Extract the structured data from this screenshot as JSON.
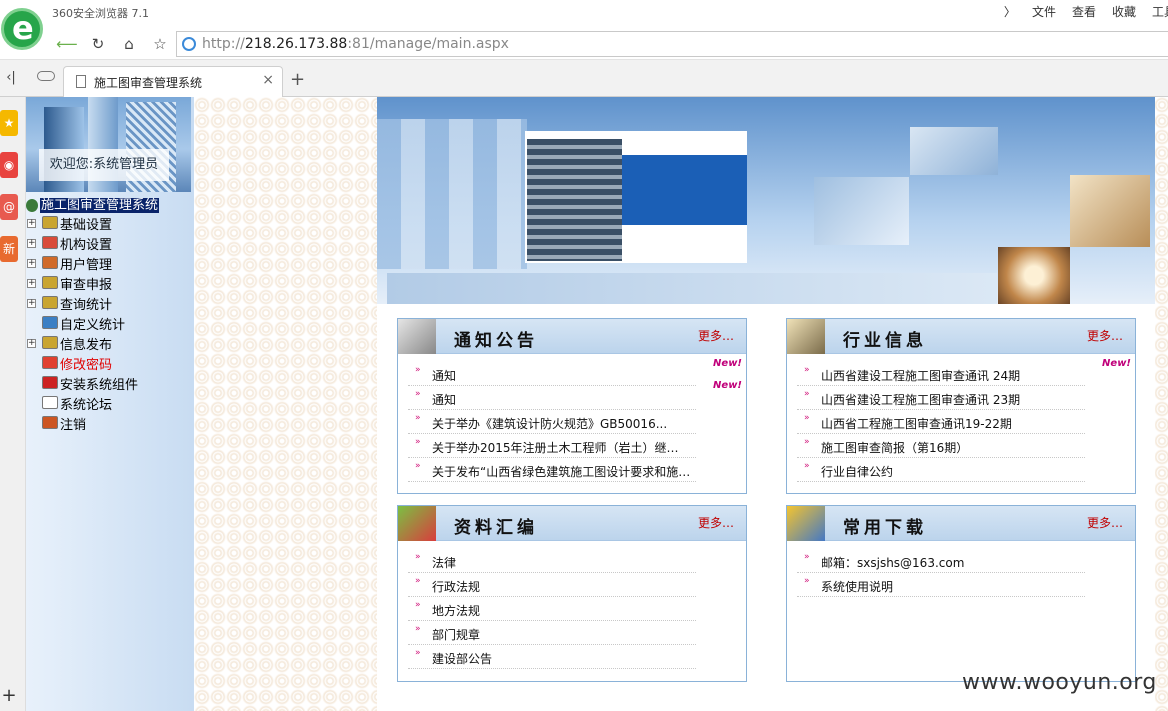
{
  "browser": {
    "app_title": "360安全浏览器 7.1",
    "menu": [
      "文件",
      "查看",
      "收藏",
      "工具"
    ],
    "url_prefix": "http://",
    "url_host": "218.26.173.88",
    "url_rest": ":81/manage/main.aspx",
    "tab_title": "施工图审查管理系统"
  },
  "left": {
    "welcome": "欢迎您:系统管理员",
    "root": "施工图审查管理系统",
    "nodes": [
      {
        "label": "基础设置",
        "expand": "+",
        "color": "#000"
      },
      {
        "label": "机构设置",
        "expand": "+",
        "color": "#000"
      },
      {
        "label": "用户管理",
        "expand": "+",
        "color": "#000"
      },
      {
        "label": "审查申报",
        "expand": "+",
        "color": "#000"
      },
      {
        "label": "查询统计",
        "expand": "+",
        "color": "#000"
      },
      {
        "label": "自定义统计",
        "expand": "",
        "color": "#000"
      },
      {
        "label": "信息发布",
        "expand": "+",
        "color": "#000"
      },
      {
        "label": "修改密码",
        "expand": "",
        "color": "#e00000"
      },
      {
        "label": "安装系统组件",
        "expand": "",
        "color": "#000"
      },
      {
        "label": "系统论坛",
        "expand": "",
        "color": "#000"
      },
      {
        "label": "注销",
        "expand": "",
        "color": "#000"
      }
    ]
  },
  "panels": {
    "notice": {
      "title": "通知公告",
      "more": "更多…",
      "items": [
        "通知",
        "通知",
        "关于举办《建筑设计防火规范》GB50016...",
        "关于举办2015年注册土木工程师（岩土）继…",
        "关于发布“山西省绿色建筑施工图设计要求和施…"
      ]
    },
    "industry": {
      "title": "行业信息",
      "more": "更多…",
      "items": [
        "山西省建设工程施工图审查通讯 24期",
        "山西省建设工程施工图审查通讯 23期",
        "山西省工程施工图审查通讯19-22期",
        "施工图审查简报（第16期）",
        "行业自律公约"
      ]
    },
    "docs": {
      "title": "资料汇编",
      "more": "更多…",
      "items": [
        "法律",
        "行政法规",
        "地方法规",
        "部门规章",
        "建设部公告"
      ]
    },
    "download": {
      "title": "常用下载",
      "more": "更多…",
      "items": [
        "邮箱：sxsjshs@163.com",
        "系统使用说明"
      ]
    }
  },
  "new_badge": "New!",
  "watermark": "www.wooyun.org"
}
